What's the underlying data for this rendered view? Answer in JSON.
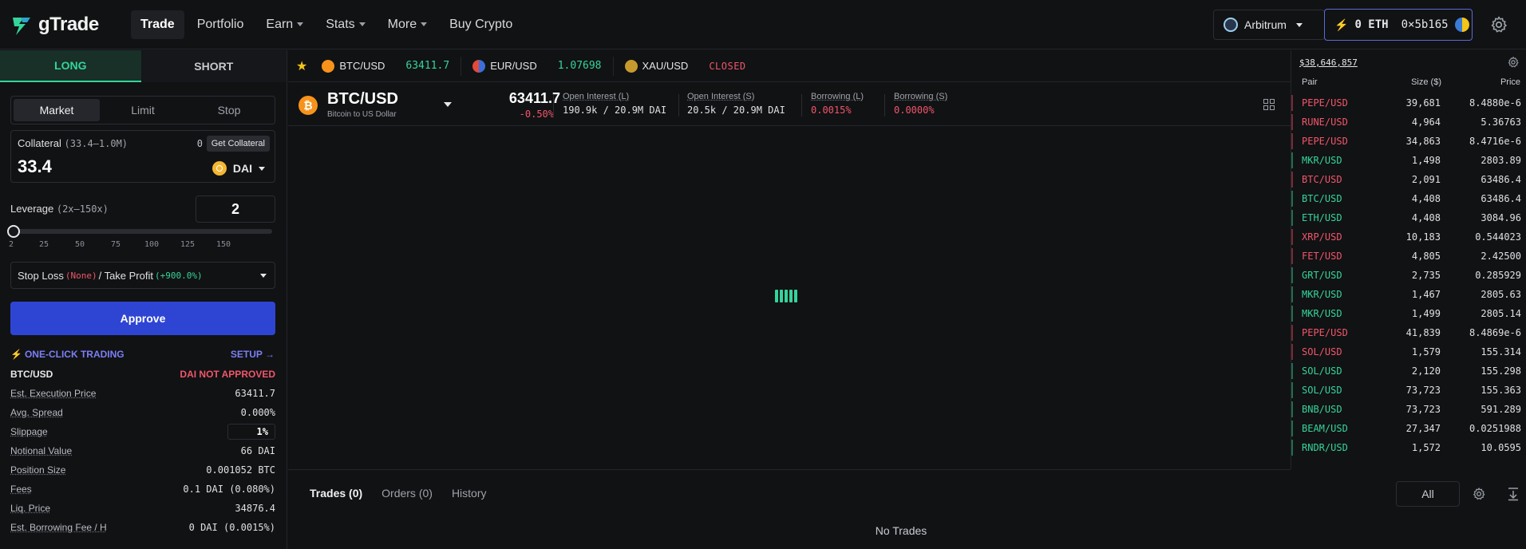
{
  "brand": {
    "name": "gTrade",
    "accent": "#35d49a",
    "primary": "#2e45d4",
    "danger": "#f0566a"
  },
  "nav": {
    "items": [
      {
        "label": "Trade",
        "active": true,
        "caret": false
      },
      {
        "label": "Portfolio",
        "active": false,
        "caret": false
      },
      {
        "label": "Earn",
        "active": false,
        "caret": true
      },
      {
        "label": "Stats",
        "active": false,
        "caret": true
      },
      {
        "label": "More",
        "active": false,
        "caret": true
      },
      {
        "label": "Buy Crypto",
        "active": false,
        "caret": false
      }
    ],
    "network": "Arbitrum",
    "wallet_balance": "0 ETH",
    "wallet_address": "0×5b165"
  },
  "order_panel": {
    "long_label": "LONG",
    "short_label": "SHORT",
    "order_types": [
      "Market",
      "Limit",
      "Stop"
    ],
    "collateral_label": "Collateral",
    "collateral_range": "(33.4–1.0M)",
    "collateral_balance": "0",
    "get_collateral": "Get Collateral",
    "collateral_value": "33.4",
    "collateral_token": "DAI",
    "leverage_label": "Leverage",
    "leverage_range": "(2x–150x)",
    "leverage_value": "2",
    "leverage_ticks": [
      "2",
      "25",
      "50",
      "75",
      "100",
      "125",
      "150"
    ],
    "sl_label": "Stop Loss",
    "sl_value": "(None)",
    "tp_label": "/ Take Profit",
    "tp_value": "(+900.0%)",
    "approve": "Approve",
    "one_click": "ONE-CLICK TRADING",
    "setup": "SETUP →",
    "pair": "BTC/USD",
    "status": "DAI NOT APPROVED",
    "info": [
      {
        "k": "Est. Execution Price",
        "v": "63411.7"
      },
      {
        "k": "Avg. Spread",
        "v": "0.000%"
      },
      {
        "k": "Slippage",
        "v": "1%"
      },
      {
        "k": "Notional Value",
        "v": "66 DAI"
      },
      {
        "k": "Position Size",
        "v": "0.001052 BTC"
      },
      {
        "k": "Fees",
        "v": "0.1 DAI (0.080%)"
      },
      {
        "k": "Liq. Price",
        "v": "34876.4"
      },
      {
        "k": "Est. Borrowing Fee / H",
        "v": "0 DAI (0.0015%)"
      }
    ]
  },
  "ticker": [
    {
      "sym": "BTC/USD",
      "val": "63411.7",
      "coin": "btc"
    },
    {
      "sym": "EUR/USD",
      "val": "1.07698",
      "coin": "eur"
    },
    {
      "sym": "XAU/USD",
      "val": "CLOSED",
      "coin": "xau"
    }
  ],
  "pair_header": {
    "name": "BTC/USD",
    "sub": "Bitcoin to US Dollar",
    "price": "63411.7",
    "change": "-0.50%",
    "stats": [
      {
        "label": "Open Interest (L)",
        "value": "190.9k / 20.9M DAI",
        "red": false
      },
      {
        "label": "Open Interest (S)",
        "value": "20.5k / 20.9M DAI",
        "red": false
      },
      {
        "label": "Borrowing (L)",
        "value": "0.0015%",
        "red": true
      },
      {
        "label": "Borrowing (S)",
        "value": "0.0000%",
        "red": true
      }
    ]
  },
  "bottom": {
    "tabs": [
      "Trades (0)",
      "Orders (0)",
      "History"
    ],
    "filter": "All",
    "empty": "No Trades"
  },
  "trades_panel": {
    "total": "$38,646,857",
    "headers": {
      "pair": "Pair",
      "size": "Size ($)",
      "price": "Price"
    },
    "rows": [
      {
        "pair": "PEPE/USD",
        "size": "39,681",
        "price": "8.4880e-6",
        "side": "short"
      },
      {
        "pair": "RUNE/USD",
        "size": "4,964",
        "price": "5.36763",
        "side": "short"
      },
      {
        "pair": "PEPE/USD",
        "size": "34,863",
        "price": "8.4716e-6",
        "side": "short"
      },
      {
        "pair": "MKR/USD",
        "size": "1,498",
        "price": "2803.89",
        "side": "long"
      },
      {
        "pair": "BTC/USD",
        "size": "2,091",
        "price": "63486.4",
        "side": "short"
      },
      {
        "pair": "BTC/USD",
        "size": "4,408",
        "price": "63486.4",
        "side": "long"
      },
      {
        "pair": "ETH/USD",
        "size": "4,408",
        "price": "3084.96",
        "side": "long"
      },
      {
        "pair": "XRP/USD",
        "size": "10,183",
        "price": "0.544023",
        "side": "short"
      },
      {
        "pair": "FET/USD",
        "size": "4,805",
        "price": "2.42500",
        "side": "short"
      },
      {
        "pair": "GRT/USD",
        "size": "2,735",
        "price": "0.285929",
        "side": "long"
      },
      {
        "pair": "MKR/USD",
        "size": "1,467",
        "price": "2805.63",
        "side": "long"
      },
      {
        "pair": "MKR/USD",
        "size": "1,499",
        "price": "2805.14",
        "side": "long"
      },
      {
        "pair": "PEPE/USD",
        "size": "41,839",
        "price": "8.4869e-6",
        "side": "short"
      },
      {
        "pair": "SOL/USD",
        "size": "1,579",
        "price": "155.314",
        "side": "short"
      },
      {
        "pair": "SOL/USD",
        "size": "2,120",
        "price": "155.298",
        "side": "long"
      },
      {
        "pair": "SOL/USD",
        "size": "73,723",
        "price": "155.363",
        "side": "long"
      },
      {
        "pair": "BNB/USD",
        "size": "73,723",
        "price": "591.289",
        "side": "long"
      },
      {
        "pair": "BEAM/USD",
        "size": "27,347",
        "price": "0.0251988",
        "side": "long"
      },
      {
        "pair": "RNDR/USD",
        "size": "1,572",
        "price": "10.0595",
        "side": "long"
      }
    ]
  }
}
